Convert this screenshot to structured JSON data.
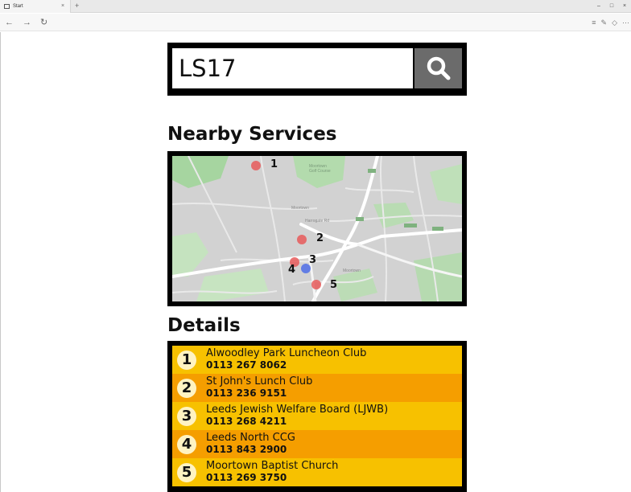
{
  "browser": {
    "tab_title": "Start",
    "tab_close": "×",
    "new_tab": "+",
    "back": "←",
    "forward": "→",
    "reload": "↻",
    "minimize": "–",
    "restore": "□",
    "close": "×"
  },
  "search": {
    "value": "LS17",
    "button_icon": "search-icon"
  },
  "nearby": {
    "heading": "Nearby Services"
  },
  "map": {
    "markers": [
      {
        "label": "1",
        "color": "#e85a5a"
      },
      {
        "label": "2",
        "color": "#e85a5a"
      },
      {
        "label": "3",
        "color": "#e85a5a"
      },
      {
        "label": "4",
        "color": "#4f6fe8"
      },
      {
        "label": "5",
        "color": "#e85a5a"
      }
    ]
  },
  "details": {
    "heading": "Details",
    "items": [
      {
        "number": "1",
        "name": "Alwoodley Park Luncheon Club",
        "phone": "0113 267 8062"
      },
      {
        "number": "2",
        "name": "St John's Lunch Club",
        "phone": "0113 236 9151"
      },
      {
        "number": "3",
        "name": "Leeds Jewish Welfare Board (LJWB)",
        "phone": "0113 268 4211"
      },
      {
        "number": "4",
        "name": "Leeds North CCG",
        "phone": "0113 843 2900"
      },
      {
        "number": "5",
        "name": "Moortown Baptist Church",
        "phone": "0113 269 3750"
      }
    ]
  },
  "colors": {
    "row_odd": "#f7c100",
    "row_even": "#f59e00",
    "search_button": "#6b6b6b",
    "frame": "#000000"
  }
}
